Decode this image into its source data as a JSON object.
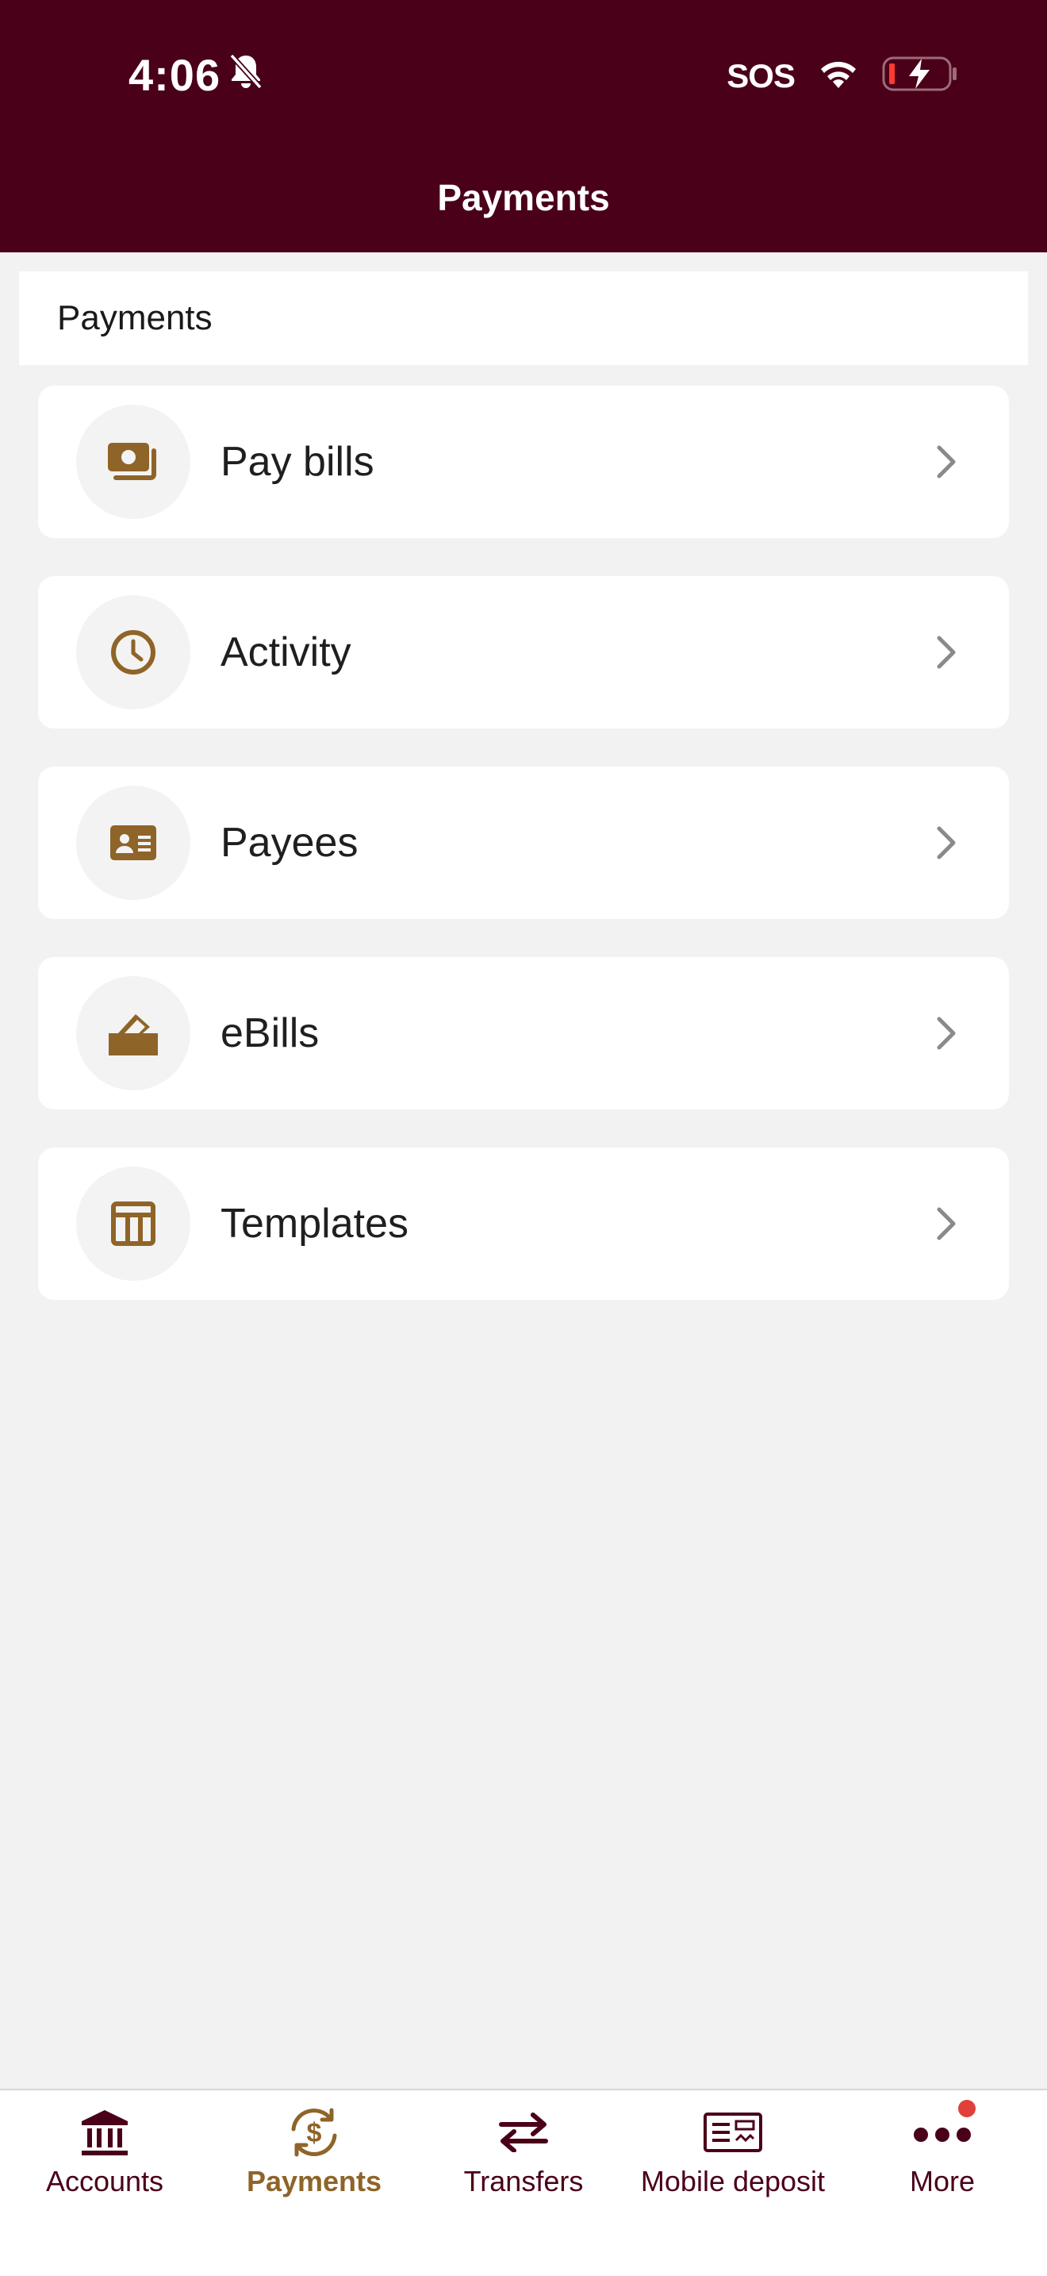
{
  "status_bar": {
    "time": "4:06",
    "carrier": "SOS",
    "icons": [
      "bell-slash-icon",
      "wifi-icon",
      "battery-charging-icon"
    ]
  },
  "header": {
    "title": "Payments"
  },
  "section": {
    "title": "Payments"
  },
  "menu": {
    "items": [
      {
        "label": "Pay bills",
        "icon": "money-bill-icon"
      },
      {
        "label": "Activity",
        "icon": "clock-icon"
      },
      {
        "label": "Payees",
        "icon": "id-card-icon"
      },
      {
        "label": "eBills",
        "icon": "envelope-open-icon"
      },
      {
        "label": "Templates",
        "icon": "template-icon"
      }
    ]
  },
  "tabbar": {
    "tabs": [
      {
        "label": "Accounts",
        "icon": "bank-icon",
        "active": false
      },
      {
        "label": "Payments",
        "icon": "dollar-cycle-icon",
        "active": true
      },
      {
        "label": "Transfers",
        "icon": "arrows-exchange-icon",
        "active": false
      },
      {
        "label": "Mobile deposit",
        "icon": "check-deposit-icon",
        "active": false
      },
      {
        "label": "More",
        "icon": "more-dots-icon",
        "active": false,
        "badge": true
      }
    ]
  },
  "colors": {
    "header_bg": "#4a0019",
    "accent_gold": "#8f6428",
    "background": "#f2f2f2",
    "badge": "#e0403a"
  }
}
